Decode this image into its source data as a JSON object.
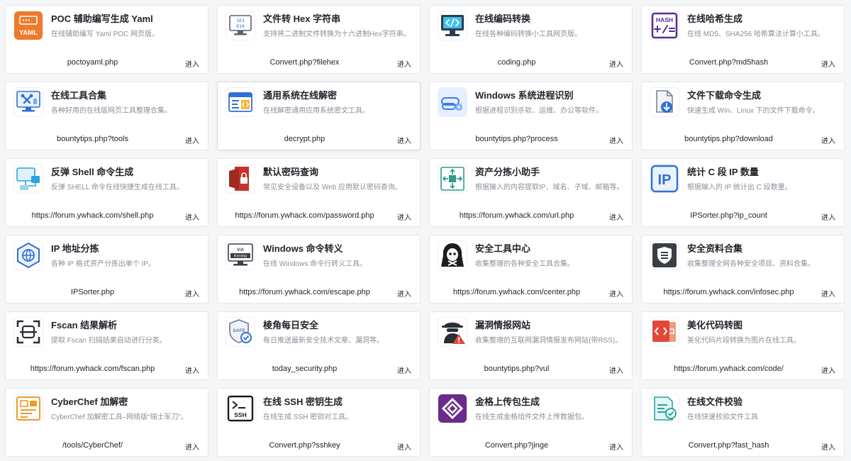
{
  "cards": [
    {
      "icon": "yaml-file-icon",
      "title": "POC 辅助编写生成 Yaml",
      "desc": "在线辅助编写 Yaml POC 网页版。",
      "url": "poctoyaml.php",
      "enter": "进入"
    },
    {
      "icon": "binary-monitor-icon",
      "title": "文件转 Hex 字符串",
      "desc": "支持将二进制文件转换为十六进制Hex字符串。",
      "url": "Convert.php?filehex",
      "enter": "进入"
    },
    {
      "icon": "code-monitor-icon",
      "title": "在线编码转换",
      "desc": "在线各种编码转换小工具网页版。",
      "url": "coding.php",
      "enter": "进入"
    },
    {
      "icon": "hash-calculator-icon",
      "title": "在线哈希生成",
      "desc": "在线 MD5、SHA256 哈希算法计算小工具。",
      "url": "Convert.php?md5hash",
      "enter": "进入"
    },
    {
      "icon": "tools-monitor-icon",
      "title": "在线工具合集",
      "desc": "各种好用的在线版网页工具整理合集。",
      "url": "bountytips.php?tools",
      "enter": "进入"
    },
    {
      "icon": "code-window-icon",
      "title": "通用系统在线解密",
      "desc": "在线解密通用应用系统密文工具。",
      "url": "decrypt.php",
      "enter": "进入"
    },
    {
      "icon": "process-gear-icon",
      "title": "Windows 系统进程识别",
      "desc": "根据进程识别杀软、运维、办公等软件。",
      "url": "bountytips.php?process",
      "enter": "进入"
    },
    {
      "icon": "file-download-icon",
      "title": "文件下载命令生成",
      "desc": "快速生成 Win、Linux 下的文件下载命令。",
      "url": "bountytips.php?download",
      "enter": "进入"
    },
    {
      "icon": "network-monitor-icon",
      "title": "反弹 Shell 命令生成",
      "desc": "反弹 SHELL 命令在线快捷生成在线工具。",
      "url": "https://forum.ywhack.com/shell.php",
      "enter": "进入"
    },
    {
      "icon": "lock-document-icon",
      "title": "默认密码查询",
      "desc": "常见安全设备以及 Web 应用默认密码查询。",
      "url": "https://forum.ywhack.com/password.php",
      "enter": "进入"
    },
    {
      "icon": "asset-split-icon",
      "title": "资产分拣小助手",
      "desc": "根据输入的内容提取IP、域名、子域、邮箱等。",
      "url": "https://forum.ywhack.com/url.php",
      "enter": "进入"
    },
    {
      "icon": "ip-icon",
      "title": "统计 C 段 IP 数量",
      "desc": "根据输入的 IP 统计出 C 段数量。",
      "url": "IPSorter.php?ip_count",
      "enter": "进入"
    },
    {
      "icon": "ip-hexagon-icon",
      "title": "IP 地址分拣",
      "desc": "各种 IP 格式资产分拣出单个 IP。",
      "url": "IPSorter.php",
      "enter": "进入"
    },
    {
      "icon": "command-monitor-icon",
      "title": "Windows 命令转义",
      "desc": "在线 Windows 命令行转义工具。",
      "url": "https://forum.ywhack.com/escape.php",
      "enter": "进入"
    },
    {
      "icon": "hacker-icon",
      "title": "安全工具中心",
      "desc": "收集整理的各种安全工具合集。",
      "url": "https://forum.ywhack.com/center.php",
      "enter": "进入"
    },
    {
      "icon": "security-shield-icon",
      "title": "安全资料合集",
      "desc": "收集整理全网各种安全项目、资料合集。",
      "url": "https://forum.ywhack.com/infosec.php",
      "enter": "进入"
    },
    {
      "icon": "face-scan-icon",
      "title": "Fscan 结果解析",
      "desc": "提取 Fscan 扫描结果自动进行分类。",
      "url": "https://forum.ywhack.com/fscan.php",
      "enter": "进入"
    },
    {
      "icon": "safe-check-icon",
      "title": "棱角每日安全",
      "desc": "每日推送最新安全技术文章、漏洞等。",
      "url": "today_security.php",
      "enter": "进入"
    },
    {
      "icon": "spy-warning-icon",
      "title": "漏洞情报网站",
      "desc": "收集整理的互联网漏洞情报发布网站(带RSS)。",
      "url": "bountytips.php?vul",
      "enter": "进入"
    },
    {
      "icon": "code-image-icon",
      "title": "美化代码转图",
      "desc": "美化代码片段转换为图片在线工具。",
      "url": "https://forum.ywhack.com/code/",
      "enter": "进入"
    },
    {
      "icon": "cyberchef-icon",
      "title": "CyberChef 加解密",
      "desc": "CyberChef 加解密工具–网络版“瑞士军刀”。",
      "url": "/tools/CyberChef/",
      "enter": "进入"
    },
    {
      "icon": "ssh-terminal-icon",
      "title": "在线 SSH 密钥生成",
      "desc": "在线生成 SSH 密钥对工具。",
      "url": "Convert.php?sshkey",
      "enter": "进入"
    },
    {
      "icon": "jinge-logo-icon",
      "title": "金格上传包生成",
      "desc": "在线生成金格组件文件上传数据包。",
      "url": "Convert.php?jinge",
      "enter": "进入"
    },
    {
      "icon": "file-verify-icon",
      "title": "在线文件校验",
      "desc": "在线快速校验文件工具",
      "url": "Convert.php?fast_hash",
      "enter": "进入"
    }
  ],
  "icon_texts": {
    "yaml": "YAML",
    "hex_top": "101",
    "hex_bottom": "010",
    "hash": "HASH",
    "ip": "IP",
    "safe": "SAFE",
    "ssh": "SSH",
    "cmd_top": "V/A",
    "cmd_bottom": "Kerning"
  },
  "colors": {
    "orange": "#ef7a2b",
    "blue": "#2f6fd6",
    "purple": "#5b2c8f",
    "red": "#e2473a",
    "teal": "#22a6a0",
    "dark": "#2a2f36"
  }
}
